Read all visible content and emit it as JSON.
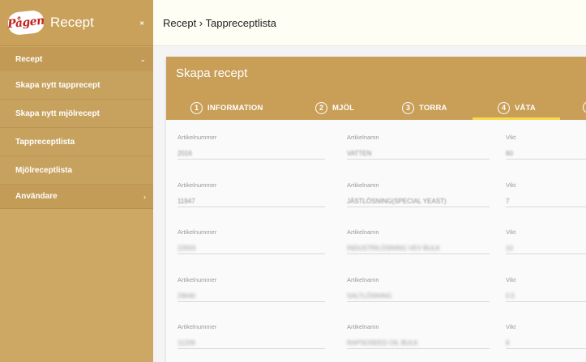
{
  "sidebar": {
    "logo_text": "Pågen",
    "title": "Recept",
    "collapse_glyph": "›‹",
    "nav": {
      "recept": {
        "label": "Recept",
        "chevron": "⌄"
      },
      "sub": [
        "Skapa nytt tapprecept",
        "Skapa nytt mjölrecept",
        "Tappreceptlista",
        "Mjölreceptlista"
      ],
      "users": {
        "label": "Användare",
        "chevron": "›"
      }
    }
  },
  "breadcrumb": "Recept › Tappreceptlista",
  "card": {
    "title": "Skapa recept",
    "steps": [
      {
        "num": "1",
        "label": "INFORMATION"
      },
      {
        "num": "2",
        "label": "MJÖL"
      },
      {
        "num": "3",
        "label": "TORRA"
      },
      {
        "num": "4",
        "label": "VÅTA",
        "active": true
      }
    ],
    "labels": {
      "art": "Artikelnummer",
      "name": "Artikelnamn",
      "vikt": "Vikt"
    },
    "rows": [
      {
        "art": "2016",
        "name": "VATTEN",
        "vikt": "60"
      },
      {
        "art": "11947",
        "name": "JÄSTLÖSNING(SPECIAL YEAST)",
        "vikt": "7"
      },
      {
        "art": "22003",
        "name": "INDUSTRILÖSNING VEV BULK",
        "vikt": "10"
      },
      {
        "art": "29040",
        "name": "SALTLÖSNING",
        "vikt": "0.5"
      },
      {
        "art": "11209",
        "name": "RAPSOSEED OIL BULK",
        "vikt": "8"
      }
    ]
  },
  "colors": {
    "sidebar": "#cda865",
    "header": "#c99f58",
    "active_step": "#f7d94c",
    "topbar": "#fffef5"
  }
}
